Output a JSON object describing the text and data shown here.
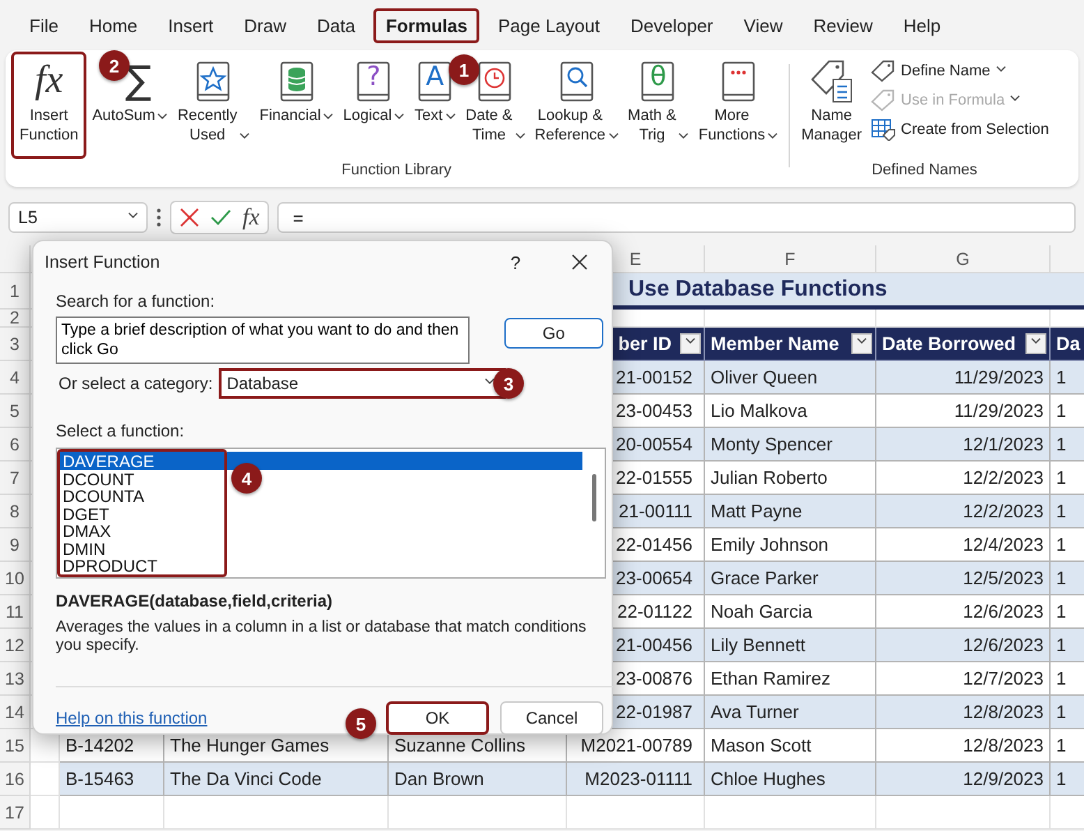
{
  "menu_tabs": [
    {
      "label": "File",
      "selected": false,
      "highlighted": false
    },
    {
      "label": "Home",
      "selected": false,
      "highlighted": false
    },
    {
      "label": "Insert",
      "selected": false,
      "highlighted": false
    },
    {
      "label": "Draw",
      "selected": false,
      "highlighted": false
    },
    {
      "label": "Data",
      "selected": false,
      "highlighted": false
    },
    {
      "label": "Formulas",
      "selected": true,
      "highlighted": true
    },
    {
      "label": "Page Layout",
      "selected": false,
      "highlighted": false
    },
    {
      "label": "Developer",
      "selected": false,
      "highlighted": false
    },
    {
      "label": "View",
      "selected": false,
      "highlighted": false
    },
    {
      "label": "Review",
      "selected": false,
      "highlighted": false
    },
    {
      "label": "Help",
      "selected": false,
      "highlighted": false
    }
  ],
  "ribbon": {
    "groups": [
      {
        "label": "Function Library",
        "buttons": [
          {
            "kind": "fx",
            "glyph": "fx",
            "label": "Insert\nFunction",
            "menu": false,
            "highlighted": true
          },
          {
            "kind": "sum",
            "glyph": "∑",
            "label": "AutoSum",
            "menu": true,
            "highlighted": false
          },
          {
            "kind": "star-book",
            "label": "Recently\nUsed",
            "menu": true,
            "highlighted": false
          },
          {
            "kind": "db-book",
            "label": "Financial",
            "menu": true,
            "highlighted": false
          },
          {
            "kind": "glyph-book",
            "glyph": "?",
            "color": "#8b4fc4",
            "label": "Logical",
            "menu": true,
            "highlighted": false
          },
          {
            "kind": "glyph-book",
            "glyph": "A",
            "color": "#1e6fc8",
            "label": "Text",
            "menu": true,
            "highlighted": false
          },
          {
            "kind": "clock-book",
            "label": "Date &\nTime",
            "menu": true,
            "highlighted": false
          },
          {
            "kind": "search-book",
            "label": "Lookup &\nReference",
            "menu": true,
            "highlighted": false
          },
          {
            "kind": "glyph-book",
            "glyph": "θ",
            "color": "#2e9a4a",
            "label": "Math &\nTrig",
            "menu": true,
            "highlighted": false
          },
          {
            "kind": "dots-book",
            "label": "More\nFunctions",
            "menu": true,
            "highlighted": false
          }
        ]
      },
      {
        "label": "Defined Names",
        "buttons": [
          {
            "kind": "name-manager",
            "label": "Name\nManager",
            "menu": false,
            "highlighted": false
          }
        ],
        "small_buttons": [
          {
            "kind": "tag",
            "label": "Define Name",
            "menu": true,
            "disabled": false
          },
          {
            "kind": "tag",
            "label": "Use in Formula",
            "menu": true,
            "disabled": true
          },
          {
            "kind": "grid",
            "label": "Create from Selection",
            "menu": false,
            "disabled": false
          }
        ]
      }
    ]
  },
  "formula_bar": {
    "name_box": "L5",
    "fx": "fx",
    "formula": "="
  },
  "sheet": {
    "column_letters": [
      "E",
      "F",
      "G"
    ],
    "row_numbers": [
      "1",
      "2",
      "3",
      "4",
      "5",
      "6",
      "7",
      "8",
      "9",
      "10",
      "11",
      "12",
      "13",
      "14",
      "15",
      "16",
      "17"
    ],
    "title": "Use Database Functions",
    "headers": {
      "member_id": "ber ID",
      "member_name": "Member Name",
      "date_borrowed": "Date Borrowed",
      "column_h": "Da"
    },
    "rows": [
      {
        "member_id": "21-00152",
        "member_name": "Oliver Queen",
        "date_borrowed": "11/29/2023",
        "column_h": "1"
      },
      {
        "member_id": "23-00453",
        "member_name": "Lio Malkova",
        "date_borrowed": "11/29/2023",
        "column_h": "1"
      },
      {
        "member_id": "20-00554",
        "member_name": "Monty Spencer",
        "date_borrowed": "12/1/2023",
        "column_h": "1"
      },
      {
        "member_id": "22-01555",
        "member_name": "Julian Roberto",
        "date_borrowed": "12/2/2023",
        "column_h": "1"
      },
      {
        "member_id": "21-00111",
        "member_name": "Matt Payne",
        "date_borrowed": "12/2/2023",
        "column_h": "1"
      },
      {
        "member_id": "22-01456",
        "member_name": "Emily Johnson",
        "date_borrowed": "12/4/2023",
        "column_h": "1"
      },
      {
        "member_id": "23-00654",
        "member_name": "Grace Parker",
        "date_borrowed": "12/5/2023",
        "column_h": "1"
      },
      {
        "member_id": "22-01122",
        "member_name": "Noah Garcia",
        "date_borrowed": "12/6/2023",
        "column_h": "1"
      },
      {
        "member_id": "21-00456",
        "member_name": "Lily Bennett",
        "date_borrowed": "12/6/2023",
        "column_h": "1"
      },
      {
        "member_id": "23-00876",
        "member_name": "Ethan Ramirez",
        "date_borrowed": "12/7/2023",
        "column_h": "1"
      },
      {
        "member_id": "22-01987",
        "member_name": "Ava Turner",
        "date_borrowed": "12/8/2023",
        "column_h": "1"
      },
      {
        "book_id": "B-14202",
        "book_title": "The Hunger Games",
        "author": "Suzanne Collins",
        "member_id": "M2021-00789",
        "member_name": "Mason Scott",
        "date_borrowed": "12/8/2023",
        "column_h": "1"
      },
      {
        "book_id": "B-15463",
        "book_title": "The Da Vinci Code",
        "author": "Dan Brown",
        "member_id": "M2023-01111",
        "member_name": "Chloe Hughes",
        "date_borrowed": "12/9/2023",
        "column_h": "1"
      }
    ]
  },
  "dialog": {
    "title": "Insert Function",
    "help_glyph": "?",
    "search_label": "Search for a function:",
    "search_value": "Type a brief description of what you want to do and then click Go",
    "go_button": "Go",
    "category_label": "Or select a category:",
    "category": {
      "value": "Database",
      "highlighted": true
    },
    "function_label": "Select a function:",
    "functions_highlighted": true,
    "functions": [
      {
        "name": "DAVERAGE",
        "selected": true
      },
      {
        "name": "DCOUNT",
        "selected": false
      },
      {
        "name": "DCOUNTA",
        "selected": false
      },
      {
        "name": "DGET",
        "selected": false
      },
      {
        "name": "DMAX",
        "selected": false
      },
      {
        "name": "DMIN",
        "selected": false
      },
      {
        "name": "DPRODUCT",
        "selected": false
      }
    ],
    "signature": "DAVERAGE(database,field,criteria)",
    "description": "Averages the values in a column in a list or database that match conditions you specify.",
    "help_link": "Help on this function",
    "buttons": [
      {
        "label": "OK",
        "highlighted": true
      },
      {
        "label": "Cancel",
        "highlighted": false
      }
    ]
  },
  "callouts": [
    {
      "number": "1"
    },
    {
      "number": "2"
    },
    {
      "number": "3"
    },
    {
      "number": "4"
    },
    {
      "number": "5"
    }
  ]
}
